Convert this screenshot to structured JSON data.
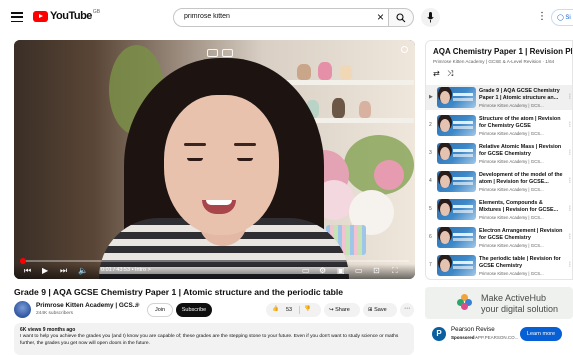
{
  "header": {
    "logo_text": "YouTube",
    "region_code": "GB",
    "search_value": "primrose kitten",
    "signin_label": "Si"
  },
  "player": {
    "time_text": "0:01 / 43:53 • Intro >",
    "progress_fraction": 0.004
  },
  "video": {
    "title": "Grade 9 | AQA GCSE Chemistry Paper 1 | Atomic structure and the periodic table",
    "channel_name": "Primrose Kitten Academy | GCS...",
    "subscribers": "244K subscribers",
    "join_label": "Join",
    "subscribe_label": "Subscribe",
    "like_count": "53",
    "share_label": "Share",
    "save_label": "Save",
    "desc_meta": "6K views  9 months ago",
    "desc_text": "I want to help you achieve the grades you (and I) know you are capable of; these grades are the stepping stone to your future. Even if you don't want to study science or maths further, the grades you get now will open doors in the future."
  },
  "playlist": {
    "title": "AQA Chemistry Paper 1 | Revision Pl...",
    "subtitle": "Primrose Kitten Academy | GCSE & A-Level Revision · 1/64",
    "items": [
      {
        "index": "▶",
        "title": "Grade 9 | AQA GCSE Chemistry Paper 1 | Atomic structure an...",
        "channel": "Primrose Kitten Academy | GCS..."
      },
      {
        "index": "2",
        "title": "Structure of the atom | Revision for Chemistry GCSE",
        "channel": "Primrose Kitten Academy | GCS..."
      },
      {
        "index": "3",
        "title": "Relative Atomic Mass | Revision for GCSE Chemistry",
        "channel": "Primrose Kitten Academy | GCS..."
      },
      {
        "index": "4",
        "title": "Development of the model of the atom | Revision for GCSE...",
        "channel": "Primrose Kitten Academy | GCS..."
      },
      {
        "index": "5",
        "title": "Elements, Compounds & Mixtures | Revision for GCSE...",
        "channel": "Primrose Kitten Academy | GCS..."
      },
      {
        "index": "6",
        "title": "Electron Arrangement | Revision for GCSE Chemistry",
        "channel": "Primrose Kitten Academy | GCS..."
      },
      {
        "index": "7",
        "title": "The periodic table | Revision for GCSE Chemistry",
        "channel": "Primrose Kitten Academy | GCS..."
      }
    ]
  },
  "ads": {
    "banner_line1": "Make ActiveHub",
    "banner_line2": "your digital solution",
    "card_name": "Pearson Revise",
    "card_sponsored": "Sponsored ·",
    "card_domain": "APP.PEARSON.CO...",
    "card_cta": "Learn more",
    "card_logo_letter": "P"
  },
  "colors": {
    "brand_red": "#ff0000",
    "accent_blue": "#065fd4",
    "text_primary": "#0f0f0f",
    "text_secondary": "#606060"
  },
  "icons": [
    "menu-icon",
    "youtube-logo-icon",
    "clear-icon",
    "search-icon",
    "mic-icon",
    "more-vert-icon",
    "user-icon",
    "play-icon",
    "next-icon",
    "volume-icon",
    "subtitles-icon",
    "settings-icon",
    "miniplayer-icon",
    "theater-icon",
    "cast-icon",
    "fullscreen-icon",
    "like-icon",
    "dislike-icon",
    "share-icon",
    "save-icon",
    "loop-icon",
    "shuffle-icon",
    "verified-icon"
  ]
}
